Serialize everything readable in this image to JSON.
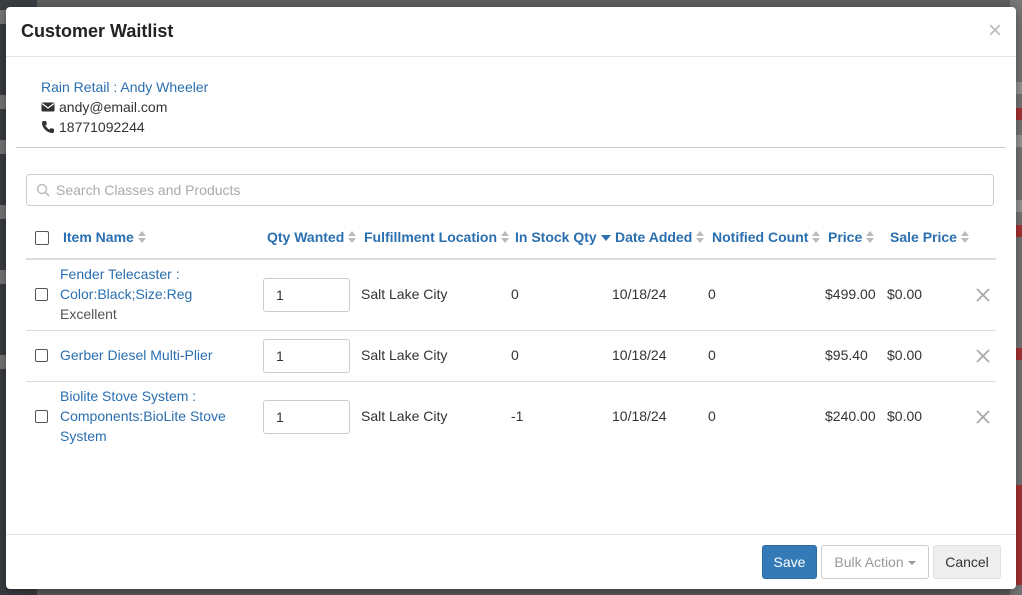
{
  "modal": {
    "title": "Customer Waitlist"
  },
  "customer": {
    "store_name": "Rain Retail : Andy Wheeler",
    "email": "andy@email.com",
    "phone": "18771092244"
  },
  "search": {
    "placeholder": "Search Classes and Products"
  },
  "columns": {
    "item_name": "Item Name",
    "qty_wanted": "Qty Wanted",
    "fulfillment_location": "Fulfillment Location",
    "in_stock_qty": "In Stock Qty",
    "date_added": "Date Added",
    "notified_count": "Notified Count",
    "price": "Price",
    "sale_price": "Sale Price"
  },
  "rows": [
    {
      "item_name": "Fender Telecaster : Color:Black;Size:Reg",
      "item_name_line1": "Fender Telecaster :",
      "item_name_line2": "Color:Black;Size:Reg",
      "condition": "Excellent",
      "qty_wanted": "1",
      "fulfillment_location": "Salt Lake City",
      "in_stock_qty": "0",
      "date_added": "10/18/24",
      "notified_count": "0",
      "price": "$499.00",
      "sale_price": "$0.00"
    },
    {
      "item_name": "Gerber Diesel Multi-Plier",
      "qty_wanted": "1",
      "fulfillment_location": "Salt Lake City",
      "in_stock_qty": "0",
      "date_added": "10/18/24",
      "notified_count": "0",
      "price": "$95.40",
      "sale_price": "$0.00"
    },
    {
      "item_name": "Biolite Stove System : Components:BioLite Stove System",
      "item_name_line1": "Biolite Stove System :",
      "item_name_line2": "Components:BioLite Stove",
      "item_name_line3": "System",
      "qty_wanted": "1",
      "fulfillment_location": "Salt Lake City",
      "in_stock_qty": "-1",
      "date_added": "10/18/24",
      "notified_count": "0",
      "price": "$240.00",
      "sale_price": "$0.00"
    }
  ],
  "footer": {
    "save_label": "Save",
    "bulk_action_label": "Bulk Action",
    "cancel_label": "Cancel"
  },
  "colors": {
    "link": "#2a6fb0",
    "primary_button": "#337ab7"
  }
}
